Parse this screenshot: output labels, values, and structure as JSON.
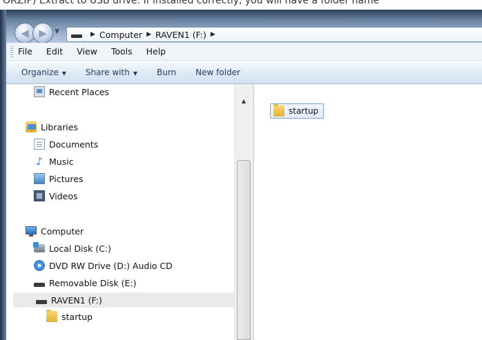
{
  "caption": "ORZIP) Extract to USB drive. If installed correctly, you will have a folder name",
  "address_bar": {
    "crumbs": [
      "Computer",
      "RAVEN1 (F:)"
    ]
  },
  "menu": [
    "File",
    "Edit",
    "View",
    "Tools",
    "Help"
  ],
  "commands": [
    {
      "label": "Organize",
      "dropdown": true
    },
    {
      "label": "Share with",
      "dropdown": true
    },
    {
      "label": "Burn",
      "dropdown": false
    },
    {
      "label": "New folder",
      "dropdown": false
    }
  ],
  "nav_pane": {
    "recent_places": "Recent Places",
    "libraries": "Libraries",
    "documents": "Documents",
    "music": "Music",
    "pictures": "Pictures",
    "videos": "Videos",
    "computer": "Computer",
    "local_disk": "Local Disk (C:)",
    "dvd_drive": "DVD RW Drive (D:) Audio CD",
    "removable_disk": "Removable Disk (E:)",
    "raven": "RAVEN1 (F:)",
    "startup": "startup"
  },
  "content": {
    "items": [
      {
        "name": "startup",
        "icon": "folder-icon"
      }
    ]
  }
}
